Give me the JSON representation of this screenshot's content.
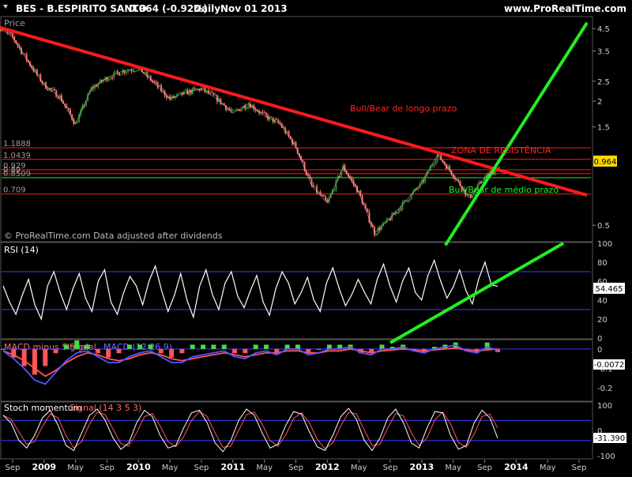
{
  "header": {
    "title": "BES - B.ESPIRITO SANTO",
    "quote": "0.964 (-0.92%)",
    "period": "Daily",
    "date": "Nov 01 2013",
    "site": "www.ProRealTime.com"
  },
  "colors": {
    "background": "#000000",
    "price": "#ffffff",
    "up_candle": "#2e8b2e",
    "down_candle": "#ff6a6a",
    "resistance": "#ff1a1a",
    "support": "#22ee22",
    "rsi": "#ffffff",
    "macd": "#5555ff",
    "signal": "#ff5555",
    "histogram_up": "#44dd44",
    "histogram_down": "#ff5555",
    "band": "#3b3bff"
  },
  "chart_data": [
    {
      "type": "line",
      "panel": "price",
      "ylabel": "Price",
      "y_scale": "log",
      "ylim": [
        0.42,
        5.1
      ],
      "y_ticks": [
        "4.5",
        "3.5",
        "2.5",
        "2",
        "1.5",
        "0.5"
      ],
      "x_ticks": [
        "Sep",
        "2009",
        "May",
        "Sep",
        "2010",
        "May",
        "Sep",
        "2011",
        "May",
        "Sep",
        "2012",
        "May",
        "Sep",
        "2013",
        "May",
        "Sep",
        "2014",
        "May",
        "Sep"
      ],
      "last_value": "0.964",
      "horizontal_levels": [
        {
          "value": 1.1888,
          "label": "1.1888"
        },
        {
          "value": 1.0439,
          "label": "1.0439"
        },
        {
          "value": 0.929,
          "label": "0.929"
        },
        {
          "value": 0.89,
          "label": "0.89"
        },
        {
          "value": 0.8509,
          "label": "0.8509"
        },
        {
          "value": 0.709,
          "label": "0.709"
        }
      ],
      "trendlines": [
        {
          "name": "Bull/Bear de longo prazo",
          "color": "resistance",
          "from": [
            "2008-07",
            4.6
          ],
          "to": [
            "2014-10",
            0.7
          ]
        },
        {
          "name": "Bull/Bear de médio prazo",
          "color": "support",
          "from": [
            "2013-04",
            0.4
          ],
          "to": [
            "2014-10",
            4.8
          ]
        }
      ],
      "annotations": [
        "Bull/Bear de longo prazo",
        "ZONA DE RESISTÊNCIA",
        "Bull/Bear de médio prazo"
      ],
      "footer": "© ProRealTime.com  Data adjusted after dividends",
      "series": [
        {
          "x": [
            "2008-07",
            "2008-09",
            "2008-11",
            "2009-01",
            "2009-03",
            "2009-05",
            "2009-07",
            "2009-09",
            "2009-11",
            "2010-01",
            "2010-03",
            "2010-05",
            "2010-07",
            "2010-09",
            "2010-11",
            "2011-01",
            "2011-03",
            "2011-05",
            "2011-07",
            "2011-09",
            "2011-11",
            "2012-01",
            "2012-03",
            "2012-05",
            "2012-07",
            "2012-09",
            "2012-11",
            "2013-01",
            "2013-03",
            "2013-05",
            "2013-07",
            "2013-09",
            "2013-11"
          ],
          "values": [
            4.6,
            4.1,
            3.1,
            2.4,
            2.1,
            1.55,
            2.3,
            2.6,
            2.8,
            2.9,
            2.45,
            2.05,
            2.2,
            2.3,
            2.05,
            1.75,
            1.95,
            1.7,
            1.55,
            1.2,
            0.78,
            0.64,
            0.96,
            0.72,
            0.46,
            0.54,
            0.66,
            0.8,
            1.1,
            0.88,
            0.68,
            0.85,
            0.964
          ]
        }
      ]
    },
    {
      "type": "line",
      "panel": "rsi",
      "title": "RSI (14)",
      "ylim": [
        0,
        100
      ],
      "y_ticks": [
        "100",
        "80",
        "60",
        "40",
        "20",
        "0"
      ],
      "bands": [
        70,
        30
      ],
      "last_value": "54.465",
      "trendlines": [
        {
          "color": "support",
          "from": [
            "2012-09",
            -5
          ],
          "to": [
            "2014-07",
            100
          ]
        }
      ],
      "series": [
        {
          "values": [
            55,
            38,
            25,
            45,
            62,
            35,
            20,
            55,
            70,
            48,
            30,
            52,
            68,
            42,
            28,
            60,
            72,
            38,
            25,
            48,
            65,
            55,
            35,
            60,
            76,
            50,
            28,
            45,
            68,
            40,
            22,
            55,
            72,
            46,
            30,
            58,
            70,
            44,
            32,
            50,
            66,
            38,
            24,
            52,
            70,
            58,
            36,
            48,
            64,
            40,
            28,
            58,
            74,
            52,
            34,
            46,
            62,
            48,
            36,
            62,
            78,
            55,
            38,
            60,
            74,
            48,
            40,
            66,
            82,
            60,
            42,
            54,
            72,
            50,
            36,
            62,
            80,
            56,
            54.465
          ]
        }
      ]
    },
    {
      "type": "line",
      "panel": "macd",
      "title": "MACD minus Signal",
      "y_ticks": [
        "0",
        "-0.1",
        "-0.2"
      ],
      "ylim": [
        -0.26,
        0.04
      ],
      "last_value": "-0.0072",
      "series": [
        {
          "name": "Signal",
          "values": [
            -0.01,
            -0.03,
            -0.06,
            -0.1,
            -0.14,
            -0.11,
            -0.07,
            -0.04,
            -0.02,
            -0.03,
            -0.05,
            -0.06,
            -0.05,
            -0.03,
            -0.02,
            -0.03,
            -0.05,
            -0.06,
            -0.05,
            -0.04,
            -0.03,
            -0.02,
            -0.03,
            -0.04,
            -0.03,
            -0.02,
            -0.02,
            -0.01,
            -0.01,
            -0.02,
            -0.02,
            -0.01,
            -0.01,
            0.0,
            -0.01,
            -0.02,
            -0.01,
            -0.005,
            0.0,
            -0.005,
            -0.01,
            -0.005,
            0.0,
            0.005,
            -0.005,
            -0.01,
            -0.005,
            0.0
          ]
        },
        {
          "name": "MACD (12 26 9)",
          "values": [
            -0.01,
            -0.05,
            -0.1,
            -0.16,
            -0.18,
            -0.12,
            -0.06,
            -0.02,
            -0.01,
            -0.04,
            -0.07,
            -0.07,
            -0.04,
            -0.02,
            -0.01,
            -0.04,
            -0.07,
            -0.07,
            -0.04,
            -0.03,
            -0.02,
            -0.01,
            -0.04,
            -0.05,
            -0.02,
            -0.01,
            -0.03,
            0.0,
            0.0,
            -0.03,
            -0.02,
            0.0,
            0.0,
            0.01,
            -0.02,
            -0.03,
            0.0,
            0.0,
            0.01,
            -0.01,
            -0.02,
            0.0,
            0.01,
            0.02,
            -0.01,
            -0.02,
            0.01,
            -0.0072
          ]
        }
      ]
    },
    {
      "type": "line",
      "panel": "stochastic",
      "title": "Stoch momentum",
      "y_ticks": [
        "100",
        "0",
        "-100"
      ],
      "bands": [
        40,
        -40
      ],
      "ylim": [
        -110,
        110
      ],
      "last_value": "-31.390",
      "series": [
        {
          "name": "Signal (14 3 5 3)",
          "values": [
            60,
            30,
            -40,
            -70,
            -20,
            50,
            80,
            20,
            -60,
            -80,
            -10,
            60,
            85,
            40,
            -30,
            -75,
            -50,
            30,
            80,
            55,
            -20,
            -70,
            -60,
            10,
            70,
            80,
            30,
            -50,
            -85,
            -40,
            40,
            85,
            60,
            -10,
            -70,
            -55,
            20,
            75,
            65,
            -5,
            -65,
            -80,
            -20,
            55,
            88,
            45,
            -40,
            -80,
            -30,
            50,
            85,
            30,
            -50,
            -70,
            10,
            75,
            70,
            -20,
            -75,
            -60,
            30,
            80,
            50,
            -31.39
          ]
        }
      ]
    }
  ]
}
